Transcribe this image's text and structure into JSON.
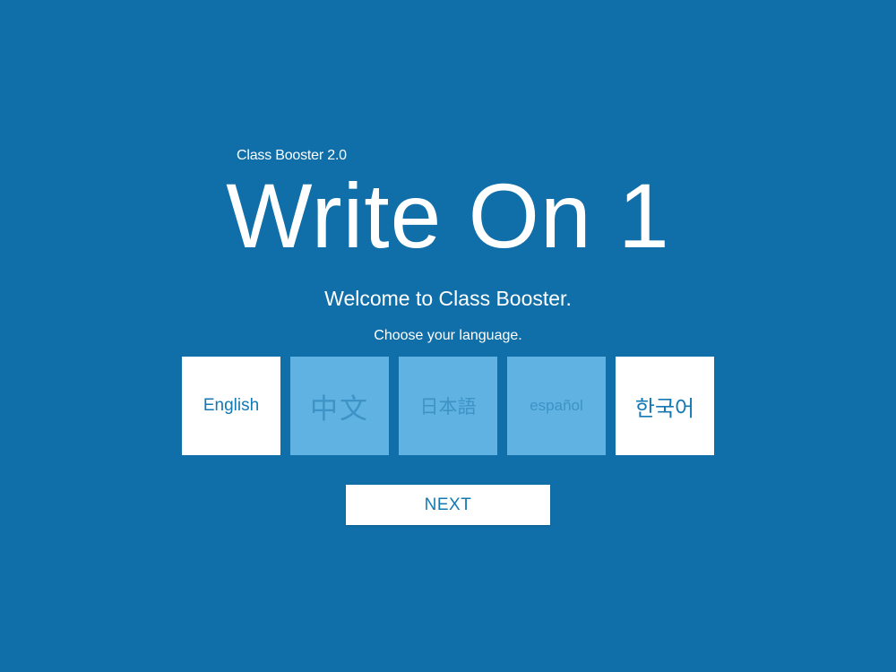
{
  "app": {
    "subtitle": "Class Booster 2.0",
    "title": "Write On 1"
  },
  "welcome": {
    "message": "Welcome to Class Booster.",
    "prompt": "Choose your language."
  },
  "languages": [
    {
      "label": "English",
      "state": "available"
    },
    {
      "label": "中文",
      "state": "dimmed"
    },
    {
      "label": "日本語",
      "state": "dimmed"
    },
    {
      "label": "español",
      "state": "dimmed"
    },
    {
      "label": "한국어",
      "state": "available"
    }
  ],
  "actions": {
    "next_label": "NEXT"
  },
  "colors": {
    "background": "#106fa8",
    "tile_available": "#ffffff",
    "tile_dimmed": "#5fb2e2",
    "accent_text": "#1478b2"
  }
}
